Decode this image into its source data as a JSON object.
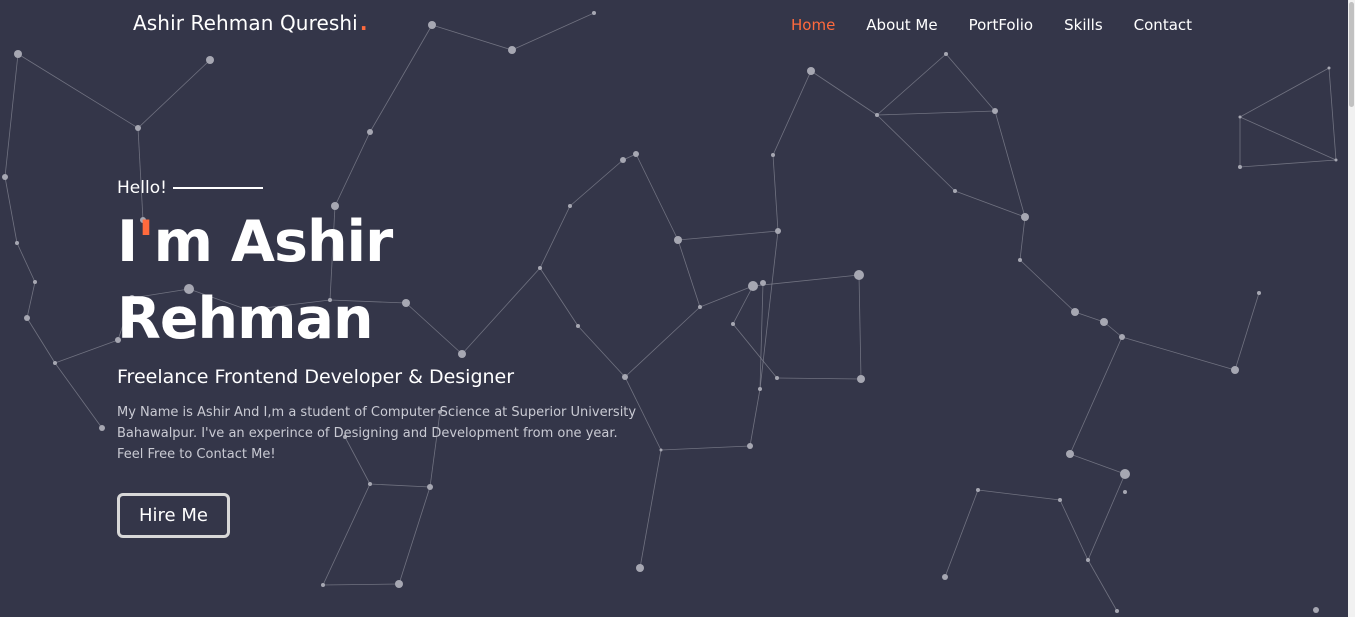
{
  "brand": {
    "name": "Ashir Rehman Qureshi",
    "dot": "."
  },
  "nav": {
    "items": [
      {
        "label": "Home",
        "active": true
      },
      {
        "label": "About Me",
        "active": false
      },
      {
        "label": "PortFolio",
        "active": false
      },
      {
        "label": "Skills",
        "active": false
      },
      {
        "label": "Contact",
        "active": false
      }
    ]
  },
  "hero": {
    "greeting": "Hello!",
    "title_line1_start": "I",
    "title_apostrophe": "'",
    "title_line1_end": "m Ashir",
    "title_line2": "Rehman",
    "subtitle": "Freelance Frontend Developer & Designer",
    "description": "My Name is Ashir And I,m a student of Computer Science at Superior University Bahawalpur. I've an experince of Designing and Development from one year. Feel Free to Contact Me!",
    "button_label": "Hire Me"
  },
  "colors": {
    "background": "#343649",
    "accent": "#ff6a3d",
    "text": "#ffffff"
  },
  "background_effect": "particle-network"
}
